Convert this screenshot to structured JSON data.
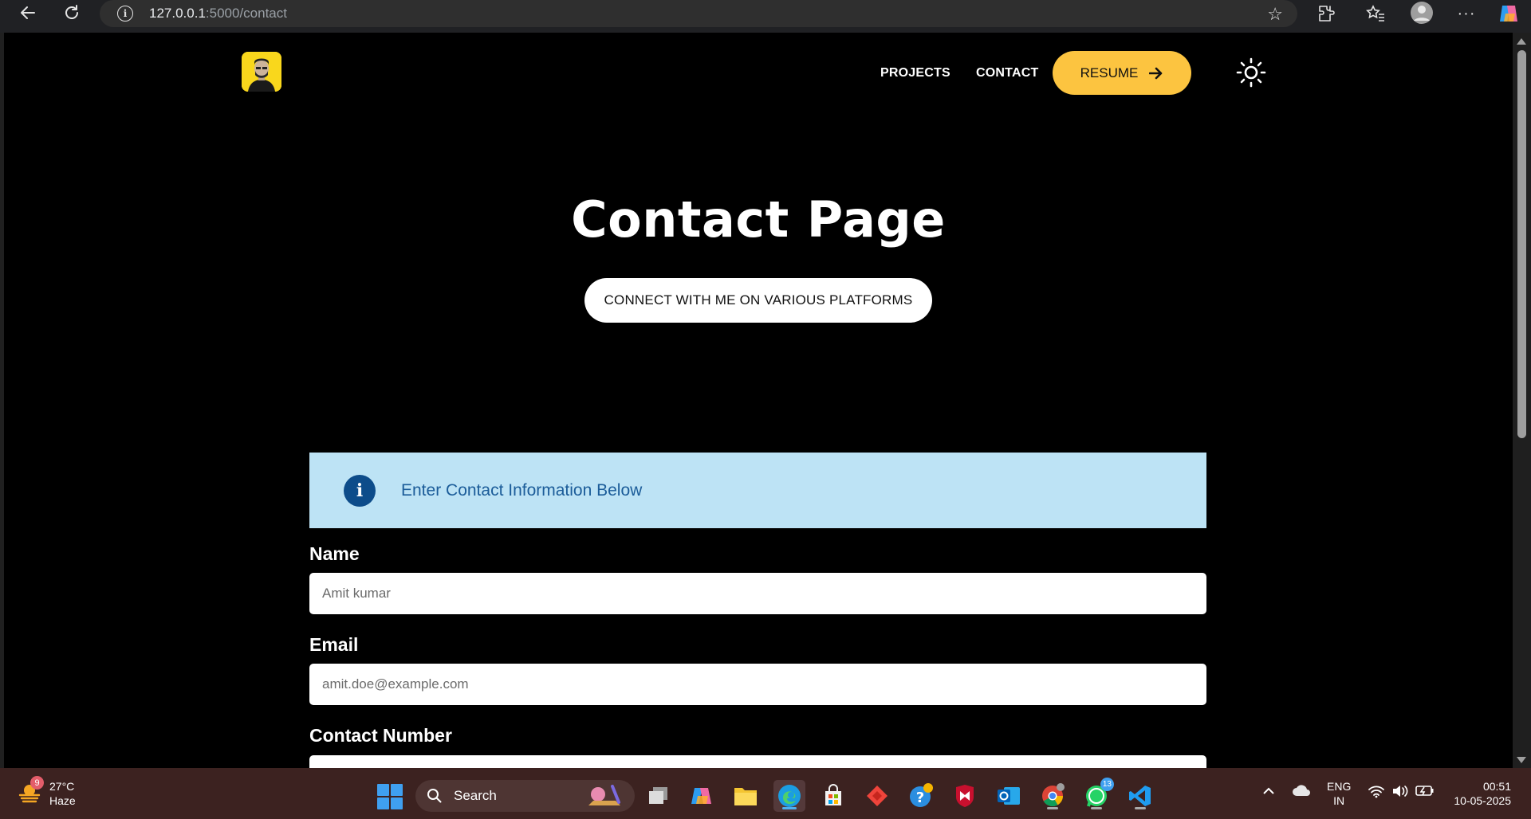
{
  "browser": {
    "url_host": "127.0.0.1",
    "url_path": ":5000/contact",
    "icons": [
      "back-icon",
      "reload-icon",
      "site-info-icon",
      "favorite-star-icon",
      "extensions-icon",
      "favorites-icon",
      "profile-icon",
      "more-icon",
      "copilot-icon"
    ]
  },
  "site": {
    "nav": {
      "projects": "PROJECTS",
      "contact": "CONTACT",
      "resume": "RESUME"
    },
    "accent": "#fcc440"
  },
  "hero": {
    "title": "Contact Page",
    "connect_label": "CONNECT WITH ME ON VARIOUS PLATFORMS"
  },
  "info": {
    "text": "Enter Contact Information Below"
  },
  "form": {
    "name_label": "Name",
    "name_placeholder": "Amit kumar",
    "email_label": "Email",
    "email_placeholder": "amit.doe@example.com",
    "contact_label": "Contact Number"
  },
  "taskbar": {
    "weather_badge": "9",
    "temperature": "27°C",
    "condition": "Haze",
    "search_label": "Search",
    "whatsapp_badge": "13",
    "lang_top": "ENG",
    "lang_bottom": "IN",
    "time": "00:51",
    "date": "10-05-2025"
  }
}
